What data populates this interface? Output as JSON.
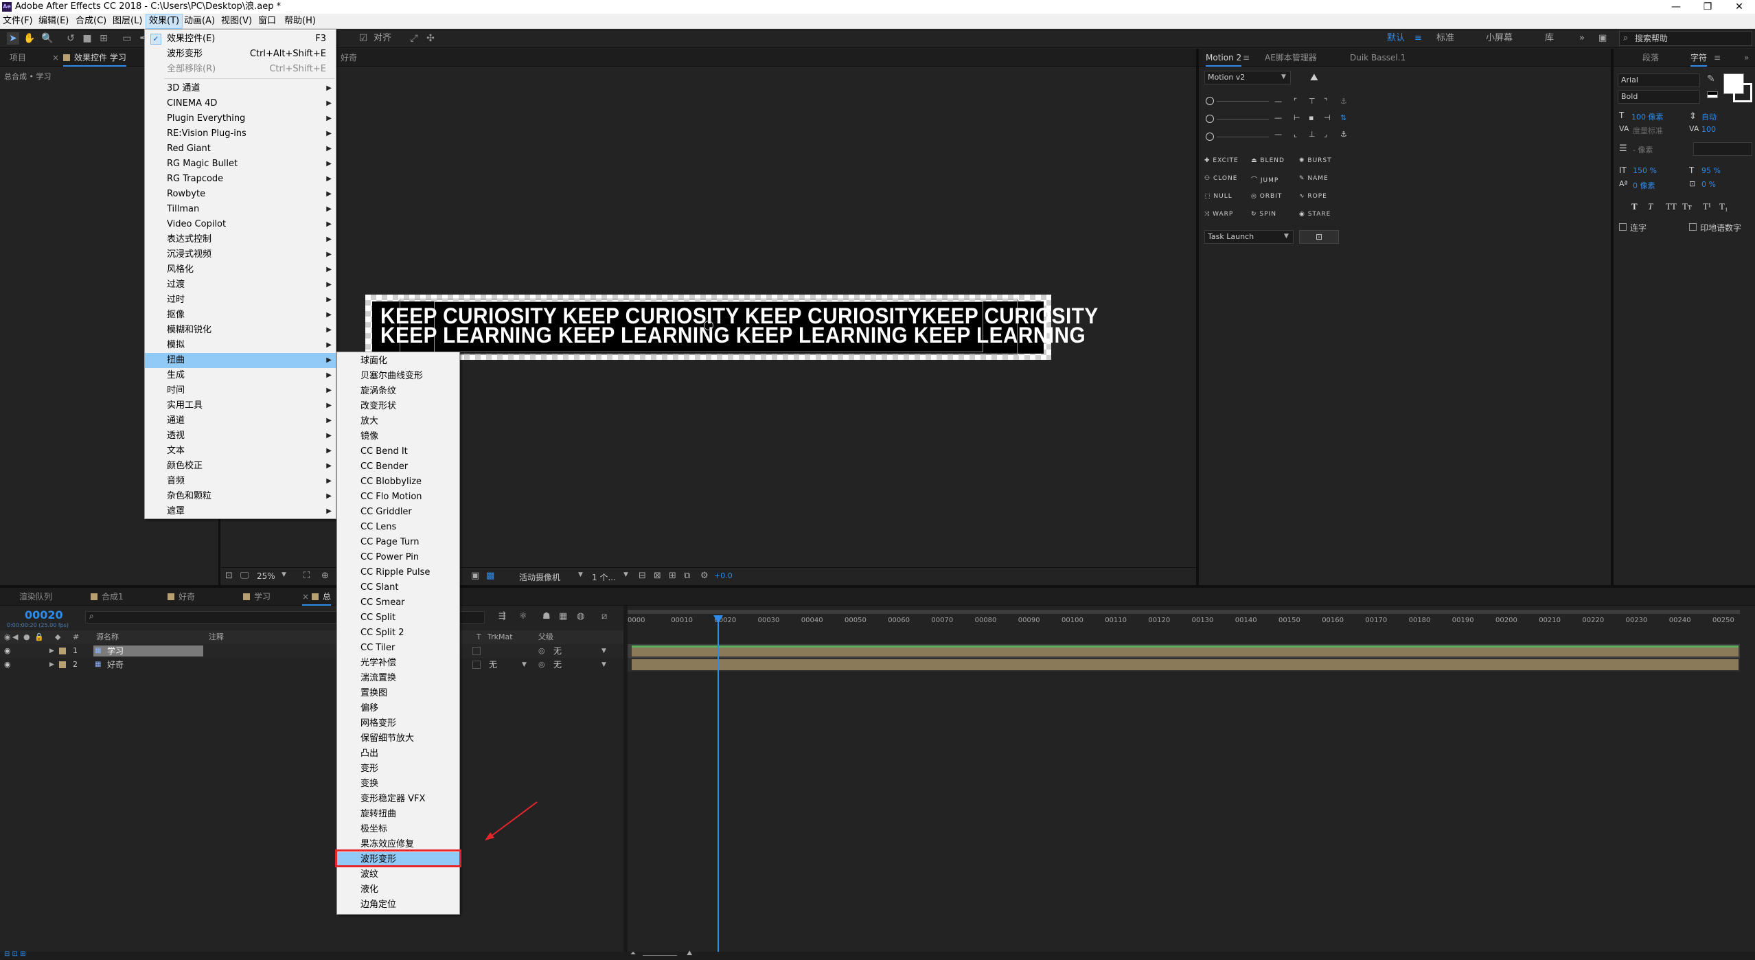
{
  "window": {
    "title": "Adobe After Effects CC 2018 - C:\\Users\\PC\\Desktop\\浪.aep *",
    "logo": "Ae",
    "minimize_icon": "—",
    "restore_icon": "❐",
    "close_icon": "✕"
  },
  "menubar": [
    "文件(F)",
    "编辑(E)",
    "合成(C)",
    "图层(L)",
    "效果(T)",
    "动画(A)",
    "视图(V)",
    "窗口",
    "帮助(H)"
  ],
  "toolbar": {
    "align_label": "对齐",
    "workspaces": [
      "默认",
      "标准",
      "小屏幕",
      "库"
    ],
    "active_workspace": "默认",
    "search_placeholder": "搜索帮助"
  },
  "project_panel": {
    "tab_project": "项目",
    "tab_effects": "效果控件 学习",
    "breadcrumb": "总合成 • 学习"
  },
  "effects_menu": {
    "items": [
      {
        "label": "效果控件(E)",
        "shortcut": "F3",
        "checked": true
      },
      {
        "label": "波形变形",
        "shortcut": "Ctrl+Alt+Shift+E"
      },
      {
        "label": "全部移除(R)",
        "shortcut": "Ctrl+Shift+E",
        "disabled": true
      },
      {
        "label": "3D 通道",
        "submenu": true
      },
      {
        "label": "CINEMA 4D",
        "submenu": true
      },
      {
        "label": "Plugin Everything",
        "submenu": true
      },
      {
        "label": "RE:Vision Plug-ins",
        "submenu": true
      },
      {
        "label": "Red Giant",
        "submenu": true
      },
      {
        "label": "RG Magic Bullet",
        "submenu": true
      },
      {
        "label": "RG Trapcode",
        "submenu": true
      },
      {
        "label": "Rowbyte",
        "submenu": true
      },
      {
        "label": "Tillman",
        "submenu": true
      },
      {
        "label": "Video Copilot",
        "submenu": true
      },
      {
        "label": "表达式控制",
        "submenu": true
      },
      {
        "label": "沉浸式视频",
        "submenu": true
      },
      {
        "label": "风格化",
        "submenu": true
      },
      {
        "label": "过渡",
        "submenu": true
      },
      {
        "label": "过时",
        "submenu": true
      },
      {
        "label": "抠像",
        "submenu": true
      },
      {
        "label": "模糊和锐化",
        "submenu": true
      },
      {
        "label": "模拟",
        "submenu": true
      },
      {
        "label": "扭曲",
        "submenu": true,
        "highlighted": true
      },
      {
        "label": "生成",
        "submenu": true
      },
      {
        "label": "时间",
        "submenu": true
      },
      {
        "label": "实用工具",
        "submenu": true
      },
      {
        "label": "通道",
        "submenu": true
      },
      {
        "label": "透视",
        "submenu": true
      },
      {
        "label": "文本",
        "submenu": true
      },
      {
        "label": "颜色校正",
        "submenu": true
      },
      {
        "label": "音频",
        "submenu": true
      },
      {
        "label": "杂色和颗粒",
        "submenu": true
      },
      {
        "label": "遮罩",
        "submenu": true
      }
    ]
  },
  "distort_submenu": {
    "items": [
      "球面化",
      "贝塞尔曲线变形",
      "旋涡条纹",
      "改变形状",
      "放大",
      "镜像",
      "CC Bend It",
      "CC Bender",
      "CC Blobbylize",
      "CC Flo Motion",
      "CC Griddler",
      "CC Lens",
      "CC Page Turn",
      "CC Power Pin",
      "CC Ripple Pulse",
      "CC Slant",
      "CC Smear",
      "CC Split",
      "CC Split 2",
      "CC Tiler",
      "光学补偿",
      "湍流置换",
      "置换图",
      "偏移",
      "网格变形",
      "保留细节放大",
      "凸出",
      "变形",
      "变换",
      "变形稳定器 VFX",
      "旋转扭曲",
      "极坐标",
      "果冻效应修复",
      "波形变形",
      "波纹",
      "液化",
      "边角定位"
    ],
    "highlighted": "波形变形"
  },
  "composition": {
    "partial_tab": "好奇",
    "text_line1": "KEEP CURIOSITY KEEP CURIOSITY KEEP CURIOSITYKEEP CURIOSITY",
    "text_line2": "KEEP LEARNING KEEP LEARNING KEEP LEARNING KEEP LEARNING",
    "zoom": "25%",
    "camera": "活动摄像机",
    "views": "1 个...",
    "exposure": "+0.0"
  },
  "motion_panel": {
    "tabs": [
      "Motion 2",
      "AE脚本管理器",
      "Duik Bassel.1"
    ],
    "version": "Motion v2",
    "buttons": [
      "EXCITE",
      "BLEND",
      "BURST",
      "CLONE",
      "JUMP",
      "NAME",
      "NULL",
      "ORBIT",
      "ROPE",
      "WARP",
      "SPIN",
      "STARE"
    ],
    "task": "Task Launch"
  },
  "char_panel": {
    "tabs": [
      "段落",
      "字符"
    ],
    "font": "Arial",
    "style": "Bold",
    "size": "100 像素",
    "leading": "自动",
    "kerning": "度量标准",
    "tracking": "100",
    "stroke": "- 像素",
    "vscale": "150 %",
    "hscale": "95 %",
    "baseline": "0 像素",
    "tsume": "0 %",
    "ligatures": "连字",
    "hindi_digits": "印地语数字",
    "typo_buttons": [
      "T",
      "T",
      "TT",
      "Tт",
      "T¹",
      "T₁"
    ]
  },
  "timeline": {
    "tabs": [
      "渲染队列",
      "合成1",
      "好奇",
      "学习",
      "总"
    ],
    "timecode": "00020",
    "timecode_sub": "0:00:00:20 (25.00 fps)",
    "col_hash": "#",
    "col_name": "源名称",
    "col_comment": "注释",
    "col_t": "T",
    "col_trkmat": "TrkMat",
    "col_parent": "父级",
    "layers": [
      {
        "num": "1",
        "name": "学习",
        "parent": "无",
        "trkmat": ""
      },
      {
        "num": "2",
        "name": "好奇",
        "parent": "无",
        "trkmat": "无"
      }
    ],
    "ruler": [
      "0000",
      "00010",
      "00020",
      "00030",
      "00040",
      "00050",
      "00060",
      "00070",
      "00080",
      "00090",
      "00100",
      "00110",
      "00120",
      "00130",
      "00140",
      "00150",
      "00160",
      "00170",
      "00180",
      "00190",
      "00200",
      "00210",
      "00220",
      "00230",
      "00240",
      "00250"
    ]
  },
  "colors": {
    "accent": "#2d8ceb",
    "menu_highlight": "#91c9f7",
    "annotation_red": "#e5252b",
    "layer_color": "#b8a070",
    "track_green": "#5fae5f"
  }
}
